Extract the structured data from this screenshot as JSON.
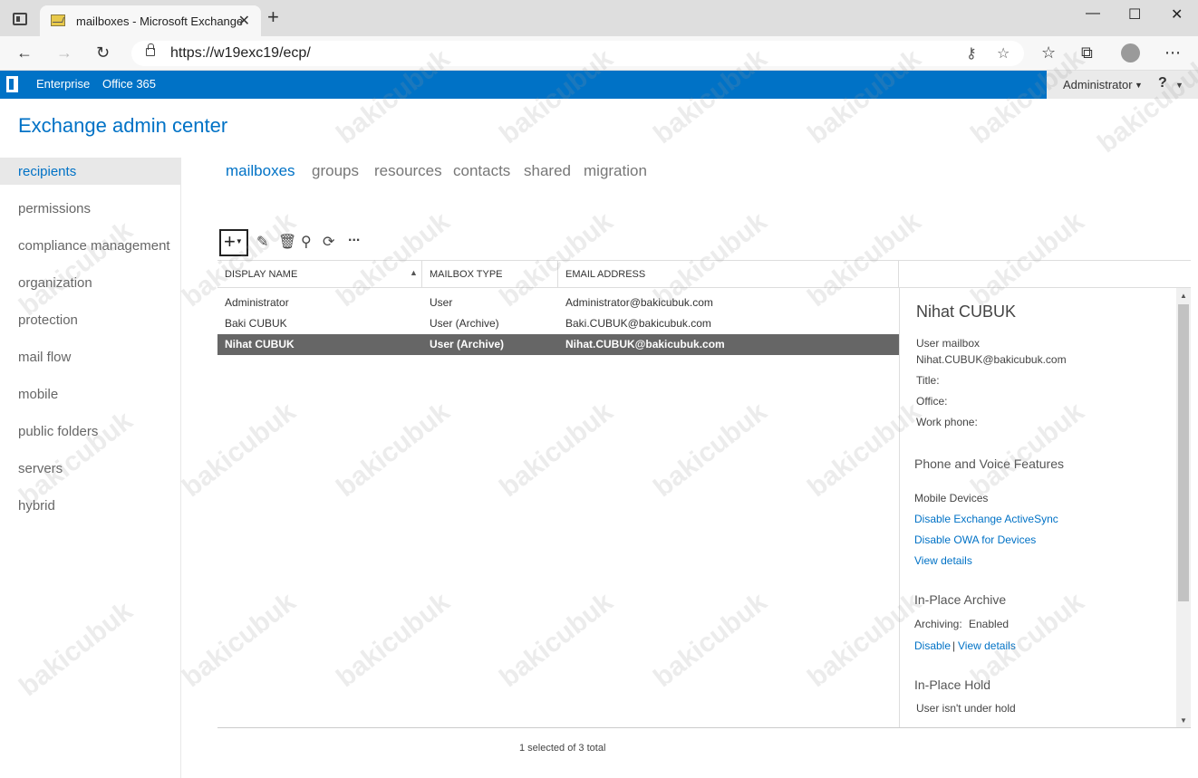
{
  "browser": {
    "tab_title": "mailboxes - Microsoft Exchange",
    "tab_close": "✕",
    "new_tab": "+",
    "url": "https://w19exc19/ecp/",
    "window_controls": [
      "—",
      "☐",
      "✕"
    ]
  },
  "o365": {
    "enterprise": "Enterprise",
    "office365": "Office 365",
    "admin": "Administrator",
    "help": "?"
  },
  "page_title": "Exchange admin center",
  "left_nav": [
    {
      "label": "recipients",
      "active": true
    },
    {
      "label": "permissions"
    },
    {
      "label": "compliance management"
    },
    {
      "label": "organization"
    },
    {
      "label": "protection"
    },
    {
      "label": "mail flow"
    },
    {
      "label": "mobile"
    },
    {
      "label": "public folders"
    },
    {
      "label": "servers"
    },
    {
      "label": "hybrid"
    }
  ],
  "sub_tabs": [
    "mailboxes",
    "groups",
    "resources",
    "contacts",
    "shared",
    "migration"
  ],
  "toolbar": {
    "more": "..."
  },
  "grid": {
    "columns": [
      "DISPLAY NAME",
      "MAILBOX TYPE",
      "EMAIL ADDRESS"
    ],
    "rows": [
      {
        "name": "Administrator",
        "type": "User",
        "email": "Administrator@bakicubuk.com"
      },
      {
        "name": "Baki CUBUK",
        "type": "User (Archive)",
        "email": "Baki.CUBUK@bakicubuk.com"
      },
      {
        "name": "Nihat CUBUK",
        "type": "User (Archive)",
        "email": "Nihat.CUBUK@bakicubuk.com",
        "selected": true
      }
    ],
    "footer": "1 selected of 3 total"
  },
  "details": {
    "name": "Nihat CUBUK",
    "type": "User mailbox",
    "email": "Nihat.CUBUK@bakicubuk.com",
    "title": "Title:",
    "office": "Office:",
    "work_phone": "Work phone:",
    "phone_voice_heading": "Phone and Voice Features",
    "mobile_devices": "Mobile Devices",
    "disable_activesync": "Disable Exchange ActiveSync",
    "disable_owa": "Disable OWA for Devices",
    "view_details": "View details",
    "archive_heading": "In-Place Archive",
    "archiving_label": "Archiving:",
    "archiving_value": "Enabled",
    "disable": "Disable",
    "separator": "|",
    "archive_view_details": "View details",
    "hold_heading": "In-Place Hold",
    "hold_status": "User isn't under hold"
  },
  "watermark": "bakicubuk",
  "colors": {
    "accent": "#0072c6",
    "selected_row": "#666666"
  }
}
